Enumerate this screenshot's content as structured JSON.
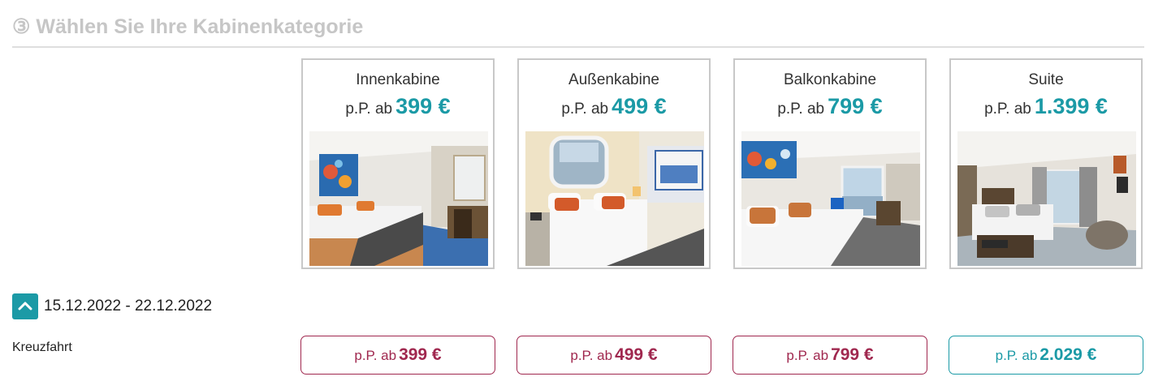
{
  "section": {
    "title": "③ Wählen Sie Ihre Kabinenkategorie"
  },
  "cabins": [
    {
      "name": "Innenkabine",
      "prefix": "p.P. ab",
      "price": "399 €"
    },
    {
      "name": "Außenkabine",
      "prefix": "p.P. ab",
      "price": "499 €"
    },
    {
      "name": "Balkonkabine",
      "prefix": "p.P. ab",
      "price": "799 €"
    },
    {
      "name": "Suite",
      "prefix": "p.P. ab",
      "price": "1.399 €"
    }
  ],
  "sailing": {
    "toggle_icon": "chevron-up-icon",
    "date_range": "15.12.2022 - 22.12.2022",
    "row_label": "Kreuzfahrt",
    "prices": [
      {
        "prefix": "p.P. ab",
        "price": "399 €"
      },
      {
        "prefix": "p.P. ab",
        "price": "499 €"
      },
      {
        "prefix": "p.P. ab",
        "price": "799 €"
      },
      {
        "prefix": "p.P. ab",
        "price": "2.029 €"
      }
    ]
  },
  "colors": {
    "accent_teal": "#1b9aa6",
    "price_crimson": "#a0284f",
    "title_gray": "#c6c6c6"
  }
}
